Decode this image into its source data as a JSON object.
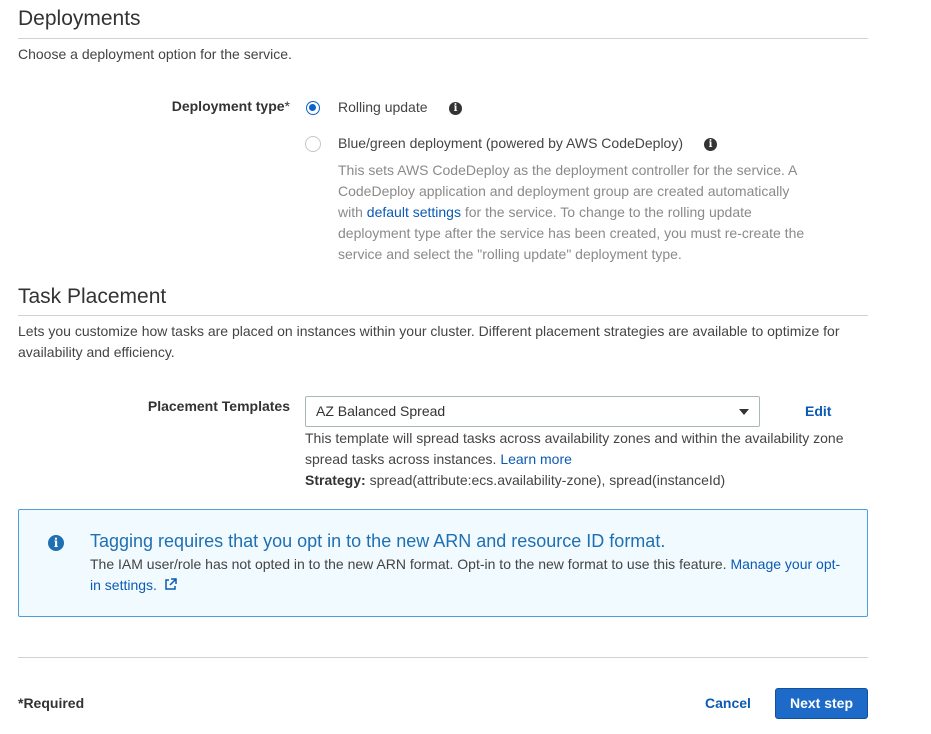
{
  "deployments": {
    "title": "Deployments",
    "description": "Choose a deployment option for the service.",
    "type_label": "Deployment type",
    "required_mark": "*",
    "options": [
      {
        "label": "Rolling update",
        "selected": true
      },
      {
        "label": "Blue/green deployment (powered by AWS CodeDeploy)",
        "selected": false
      }
    ],
    "bg_help_part1": "This sets AWS CodeDeploy as the deployment controller for the service. A CodeDeploy application and deployment group are created automatically with ",
    "bg_help_link": "default settings",
    "bg_help_part2": " for the service. To change to the rolling update deployment type after the service has been created, you must re-create the service and select the \"rolling update\" deployment type."
  },
  "task_placement": {
    "title": "Task Placement",
    "description": "Lets you customize how tasks are placed on instances within your cluster. Different placement strategies are available to optimize for availability and efficiency.",
    "templates_label": "Placement Templates",
    "selected_template": "AZ Balanced Spread",
    "edit_label": "Edit",
    "template_help": "This template will spread tasks across availability zones and within the availability zone spread tasks across instances. ",
    "learn_more": "Learn more",
    "strategy_label": "Strategy:",
    "strategy_value": " spread(attribute:ecs.availability-zone), spread(instanceId)"
  },
  "alert": {
    "title": "Tagging requires that you opt in to the new ARN and resource ID format.",
    "body": "The IAM user/role has not opted in to the new ARN format. Opt-in to the new format to use this feature. ",
    "link": "Manage your opt-in settings.",
    "icon": "info-icon",
    "color": "#1f6fb3"
  },
  "footer": {
    "required_note": "*Required",
    "cancel_label": "Cancel",
    "next_label": "Next step"
  },
  "colors": {
    "accent": "#1d6ac9",
    "link": "#0b5ab4"
  }
}
